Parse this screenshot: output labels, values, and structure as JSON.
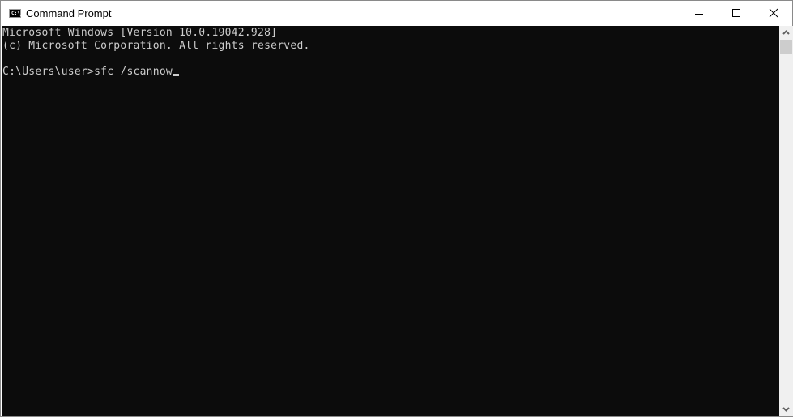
{
  "window": {
    "title": "Command Prompt",
    "icon": "cmd-icon",
    "icon_text": "C:\\_",
    "controls": [
      "minimize",
      "maximize",
      "close"
    ]
  },
  "console": {
    "lines": [
      "Microsoft Windows [Version 10.0.19042.928]",
      "(c) Microsoft Corporation. All rights reserved.",
      "",
      "C:\\Users\\user>sfc /scannow"
    ],
    "foreground": "#cccccc",
    "background": "#0c0c0c"
  }
}
